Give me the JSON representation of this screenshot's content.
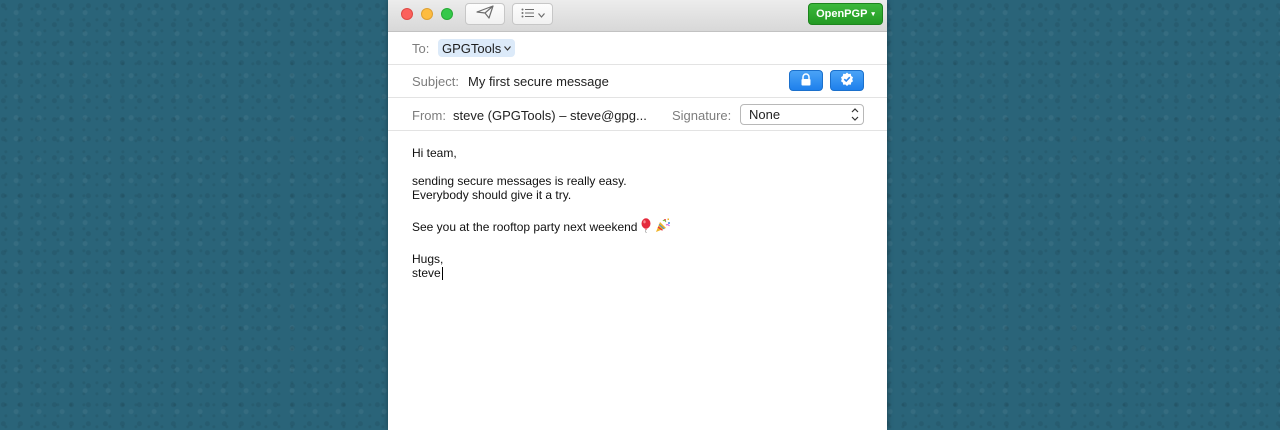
{
  "toolbar": {
    "openpgp_label": "OpenPGP",
    "openpgp_arrow": "▾",
    "openpgp_color": "#2aa52a"
  },
  "header": {
    "to_label": "To:",
    "to_recipient": "GPGTools",
    "subject_label": "Subject:",
    "subject_value": "My first secure message",
    "from_label": "From:",
    "from_value": "steve (GPGTools) – steve@gpg...",
    "signature_label": "Signature:",
    "signature_value": "None"
  },
  "message": {
    "line1": "Hi team,",
    "line2": "sending secure messages is really easy.",
    "line3": "Everybody should give it a try.",
    "line4": "See you at the rooftop party next weekend",
    "line5": "Hugs,",
    "line6": "steve"
  },
  "icons": {
    "send": "paper-plane-icon",
    "format": "list-icon",
    "encrypt": "lock-icon",
    "sign": "check-seal-icon",
    "balloon": "balloon-emoji",
    "party": "party-popper-emoji"
  }
}
